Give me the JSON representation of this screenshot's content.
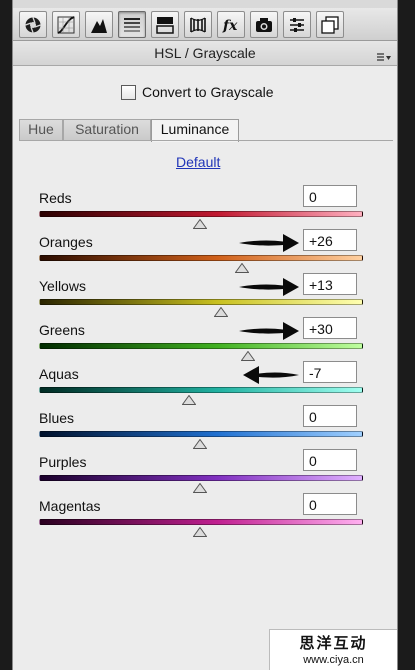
{
  "toolbar": {
    "tools": [
      {
        "icon": "basic-aperture-icon",
        "active": false
      },
      {
        "icon": "tone-curve-icon",
        "active": false
      },
      {
        "icon": "detail-icon",
        "active": false
      },
      {
        "icon": "hsl-grayscale-icon",
        "active": true
      },
      {
        "icon": "split-toning-icon",
        "active": false
      },
      {
        "icon": "lens-corrections-icon",
        "active": false
      },
      {
        "icon": "effects-fx-icon",
        "active": false
      },
      {
        "icon": "camera-calibration-icon",
        "active": false
      },
      {
        "icon": "presets-icon",
        "active": false
      },
      {
        "icon": "snapshots-icon",
        "active": false
      }
    ]
  },
  "panel": {
    "title": "HSL / Grayscale",
    "menu_icon": "panel-menu-icon",
    "convert_label": "Convert to Grayscale",
    "convert_checked": false,
    "tabs": [
      "Hue",
      "Saturation",
      "Luminance"
    ],
    "active_tab": "Luminance",
    "default_label": "Default"
  },
  "sliders": [
    {
      "label": "Reds",
      "value": "0",
      "fraction": 0.5
    },
    {
      "label": "Oranges",
      "value": "+26",
      "fraction": 0.63
    },
    {
      "label": "Yellows",
      "value": "+13",
      "fraction": 0.565
    },
    {
      "label": "Greens",
      "value": "+30",
      "fraction": 0.65
    },
    {
      "label": "Aquas",
      "value": "-7",
      "fraction": 0.465
    },
    {
      "label": "Blues",
      "value": "0",
      "fraction": 0.5
    },
    {
      "label": "Purples",
      "value": "0",
      "fraction": 0.5
    },
    {
      "label": "Magentas",
      "value": "0",
      "fraction": 0.5
    }
  ],
  "annotations": [
    {
      "slider": "Oranges",
      "icon": "arrow-right-icon"
    },
    {
      "slider": "Yellows",
      "icon": "arrow-right-icon"
    },
    {
      "slider": "Greens",
      "icon": "arrow-right-icon"
    },
    {
      "slider": "Aquas",
      "icon": "arrow-left-icon"
    }
  ],
  "watermark": {
    "line1": "思洋互动",
    "line2": "www.ciya.cn"
  },
  "colors": {
    "panel_bg": "#ececec",
    "link": "#2035b8",
    "reds_gradient": [
      "#2a0000",
      "#c01830",
      "#ffb0c0"
    ],
    "oranges_gradient": [
      "#2a0c00",
      "#d0601a",
      "#ffd0a0"
    ],
    "yellows_gradient": [
      "#2a2400",
      "#c8c020",
      "#ffffb0"
    ],
    "greens_gradient": [
      "#002a00",
      "#40b020",
      "#c0ffa0"
    ],
    "aquas_gradient": [
      "#002a22",
      "#20b0a0",
      "#a0fff0"
    ],
    "blues_gradient": [
      "#00102a",
      "#2070d0",
      "#a0d0ff"
    ],
    "purples_gradient": [
      "#1a002a",
      "#8030c0",
      "#e0b0ff"
    ],
    "magentas_gradient": [
      "#2a0020",
      "#c02090",
      "#ffb0f0"
    ]
  }
}
